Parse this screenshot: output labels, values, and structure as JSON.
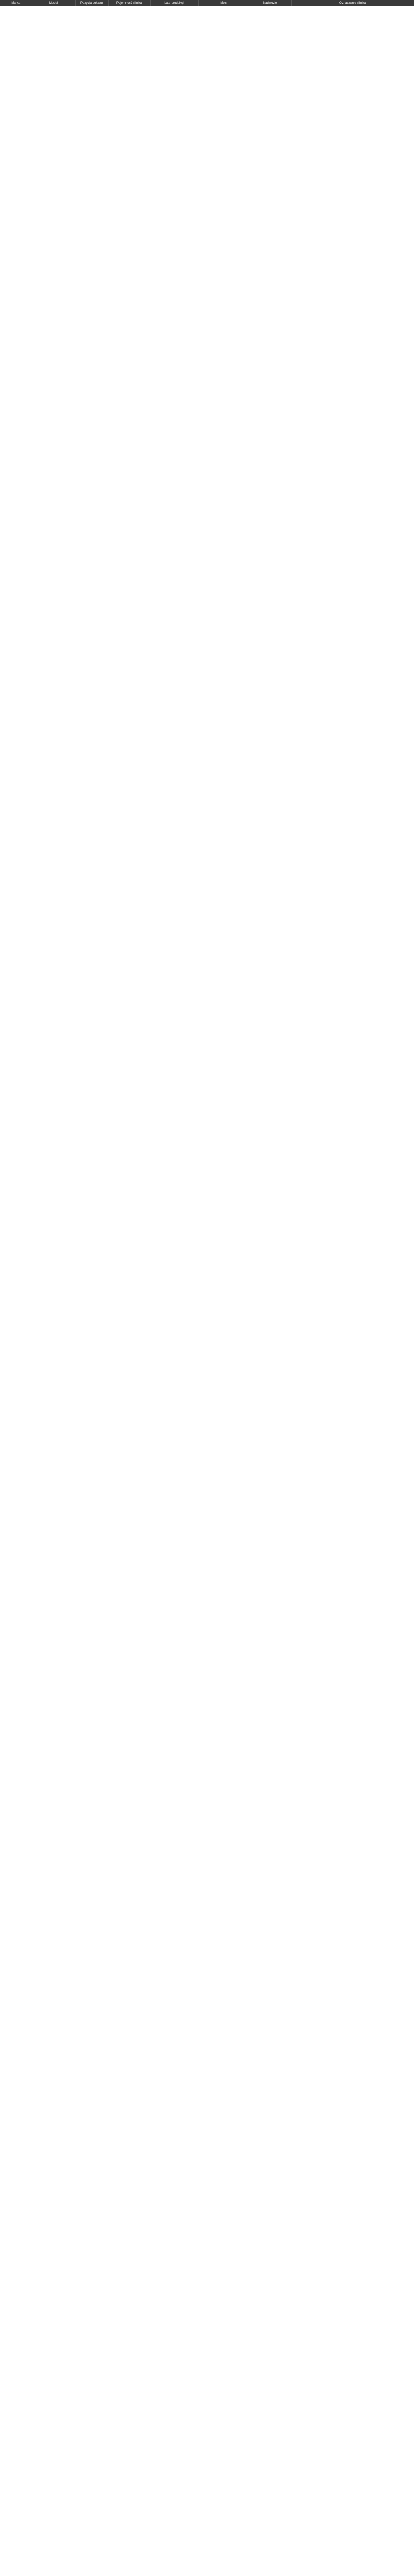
{
  "table": {
    "headers": [
      "Marka",
      "Model",
      "Pozycja pokazu",
      "Pojemność silnika",
      "Lata produkcji",
      "Moc",
      "Nadwozie",
      "Oznaczenie silnika"
    ],
    "rows": []
  }
}
